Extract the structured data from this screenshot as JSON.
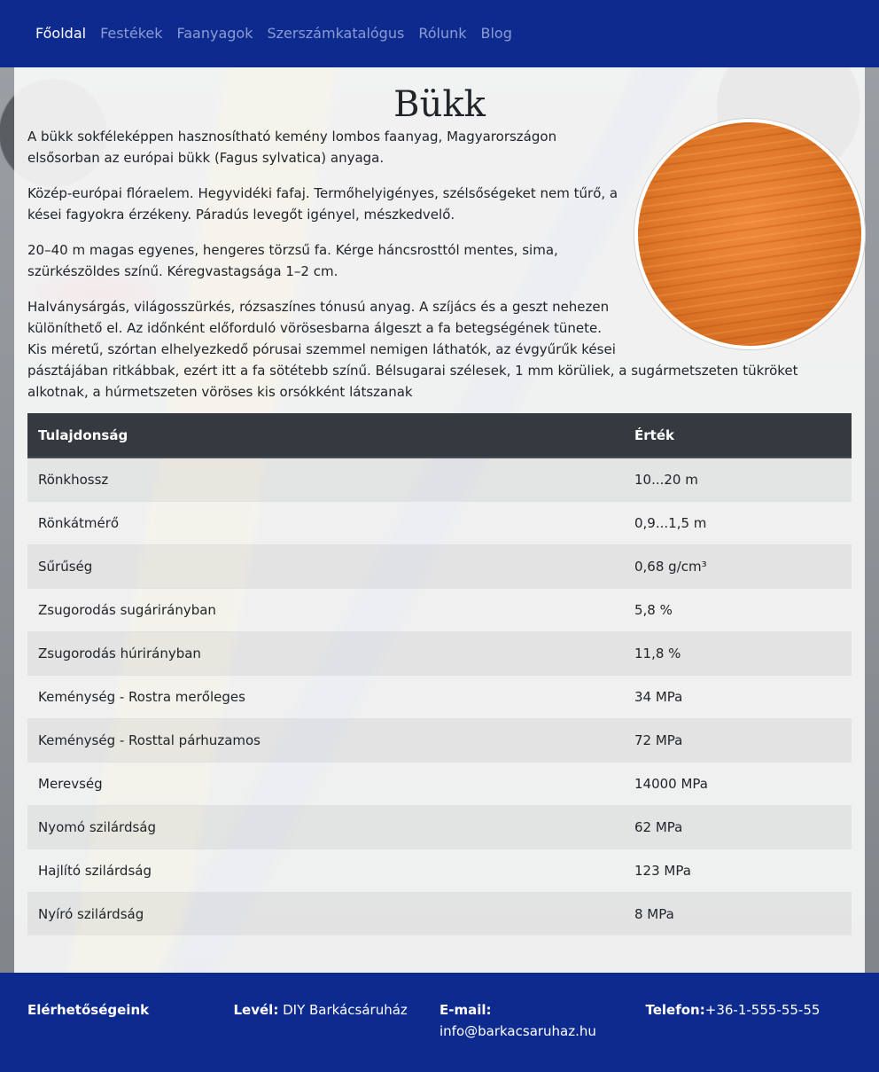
{
  "nav": {
    "items": [
      "Főoldal",
      "Festékek",
      "Faanyagok",
      "Szerszámkatalógus",
      "Rólunk",
      "Blog"
    ]
  },
  "page": {
    "title": "Bükk",
    "image_alt": "bükk faanyag",
    "paragraphs": [
      "A bükk sokféleképpen hasznosítható kemény lombos faanyag, Magyarországon elsősorban az európai bükk (Fagus sylvatica) anyaga.",
      "Közép-európai flóraelem. Hegyvidéki fafaj. Termőhelyigényes, szélsőségeket nem tűrő, a kései fagyokra érzékeny. Páradús levegőt igényel, mészkedvelő.",
      "20–40 m magas egyenes, hengeres törzsű fa. Kérge háncsrosttól mentes, sima, szürkészöldes színű. Kéregvastagsága 1–2 cm.",
      "Halványsárgás, világosszürkés, rózsaszínes tónusú anyag. A szíjács és a geszt nehezen különíthető el. Az időnként előforduló vörösesbarna álgeszt a fa betegségének tünete. Kis méretű, szórtan elhelyezkedő pórusai szemmel nemigen láthatók, az évgyűrűk kései pásztájában ritkábbak, ezért itt a fa sötétebb színű. Bélsugarai szélesek, 1 mm körüliek, a sugármetszeten tükröket alkotnak, a húrmetszeten vöröses kis orsókként látszanak"
    ]
  },
  "table": {
    "headers": [
      "Tulajdonság",
      "Érték"
    ],
    "rows": [
      [
        "Rönkhossz",
        "10...20 m"
      ],
      [
        "Rönkátmérő",
        "0,9...1,5 m"
      ],
      [
        "Sűrűség",
        "0,68 g/cm³"
      ],
      [
        "Zsugorodás sugárirányban",
        "5,8 %"
      ],
      [
        "Zsugorodás húrirányban",
        "11,8 %"
      ],
      [
        "Keménység - Rostra merőleges",
        "34 MPa"
      ],
      [
        "Keménység - Rosttal párhuzamos",
        "72 MPa"
      ],
      [
        "Merevség",
        "14000 MPa"
      ],
      [
        "Nyomó szilárdság",
        "62 MPa"
      ],
      [
        "Hajlító szilárdság",
        "123 MPa"
      ],
      [
        "Nyíró szilárdság",
        "8 MPa"
      ]
    ]
  },
  "footer": {
    "heading": "Elérhetőségeink",
    "mail_label": "Levél:",
    "mail_value": "DIY Barkácsáruház",
    "email_label": "E-mail:",
    "email_value": "info@barkacsaruhaz.hu",
    "phone_label": "Telefon:",
    "phone_value": "+36-1-555-55-55"
  },
  "colors": {
    "navbar": "#0d2b8f",
    "table_header": "#343a40"
  }
}
